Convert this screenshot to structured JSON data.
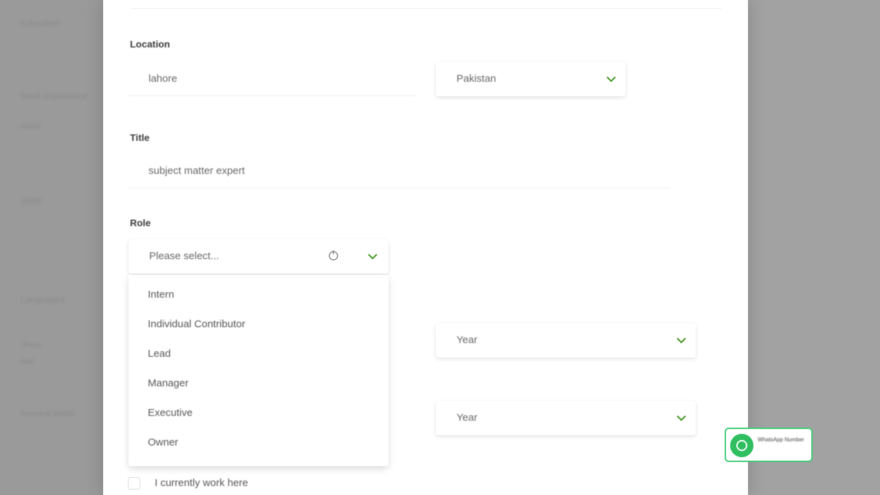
{
  "background": {
    "items": [
      "Education",
      "Work experience",
      "About",
      "Skills",
      "Languages",
      "Share",
      "Add",
      "Personal details"
    ]
  },
  "form": {
    "location": {
      "label": "Location",
      "city_value": "lahore",
      "country_value": "Pakistan"
    },
    "title": {
      "label": "Title",
      "value": "subject matter expert"
    },
    "role": {
      "label": "Role",
      "placeholder": "Please select...",
      "options": [
        "Intern",
        "Individual Contributor",
        "Lead",
        "Manager",
        "Executive",
        "Owner"
      ]
    },
    "start_year": {
      "value": "Year"
    },
    "end_year": {
      "value": "Year"
    },
    "current_job": {
      "label": "I currently work here"
    }
  },
  "badge": {
    "text": "WhatsApp Number"
  },
  "colors": {
    "accent_green": "#3ecb76",
    "chevron_green": "#4c9a2a",
    "overlay": "#9a9a9a"
  },
  "icons": {
    "chevron": "chevron-down-icon",
    "cursor": "hand-cursor-icon",
    "whatsapp": "whatsapp-icon"
  }
}
